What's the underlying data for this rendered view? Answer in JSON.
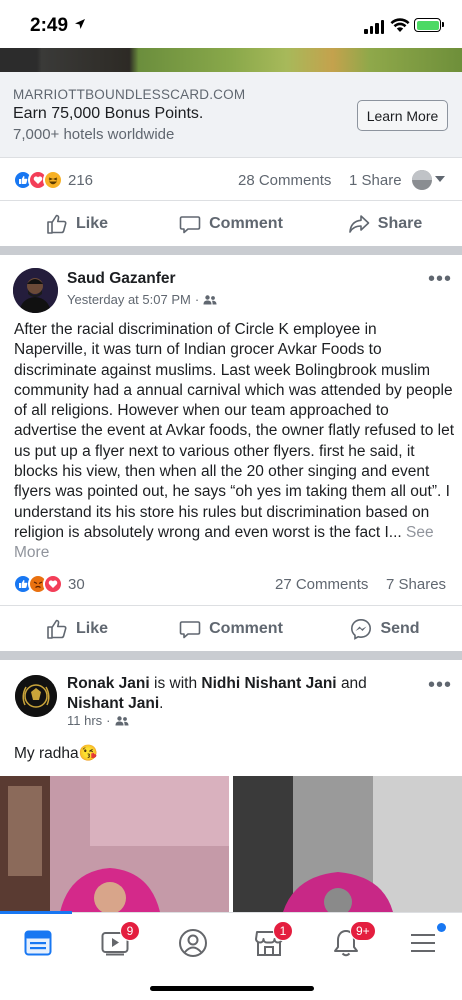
{
  "status_bar": {
    "time": "2:49"
  },
  "ad": {
    "domain": "MARRIOTTBOUNDLESSCARD.COM",
    "headline": "Earn 75,000 Bonus Points.",
    "description": "7,000+ hotels worldwide",
    "cta": "Learn More",
    "reaction_count": "216",
    "comments": "28 Comments",
    "shares": "1 Share",
    "actions": {
      "like": "Like",
      "comment": "Comment",
      "share": "Share"
    }
  },
  "post1": {
    "author": "Saud Gazanfer",
    "time": "Yesterday at 5:07 PM",
    "text": "After the racial discrimination of Circle K employee in Naperville, it was turn of Indian grocer Avkar Foods to discriminate against muslims. Last week Bolingbrook muslim community had a annual carnival which was attended by people of all religions. However when our team approached to advertise the event at Avkar foods, the owner flatly refused to let us put up a flyer next to various other flyers. first he said, it blocks his view, then when all the 20 other singing and event flyers was pointed out, he says “oh yes im taking them all out”. I understand its his store his rules but discrimination based on religion is absolutely wrong and even worst is the fact I...",
    "see_more": "See More",
    "reaction_count": "30",
    "comments": "27 Comments",
    "shares": "7 Shares",
    "actions": {
      "like": "Like",
      "comment": "Comment",
      "send": "Send"
    }
  },
  "post2": {
    "author": "Ronak Jani",
    "with_text": "is with",
    "tagged1": "Nidhi Nishant Jani",
    "and_text": "and",
    "tagged2": "Nishant Jani",
    "period": ".",
    "time": "11 hrs",
    "text": "My radha😘"
  },
  "tabbar": {
    "badges": {
      "watch": "9",
      "marketplace": "1",
      "notifications": "9+"
    }
  },
  "colors": {
    "accent": "#1877f2",
    "badge": "#e41e3f",
    "separator": "#c9ccd1"
  },
  "icons": [
    "location-arrow-icon",
    "signal-icon",
    "wifi-icon",
    "battery-icon",
    "like-reaction-icon",
    "love-reaction-icon",
    "haha-reaction-icon",
    "angry-reaction-icon",
    "thumbs-up-icon",
    "comment-icon",
    "share-icon",
    "messenger-icon",
    "friends-icon",
    "more-options-icon",
    "news-feed-icon",
    "watch-icon",
    "profile-icon",
    "marketplace-icon",
    "bell-icon",
    "menu-icon"
  ]
}
